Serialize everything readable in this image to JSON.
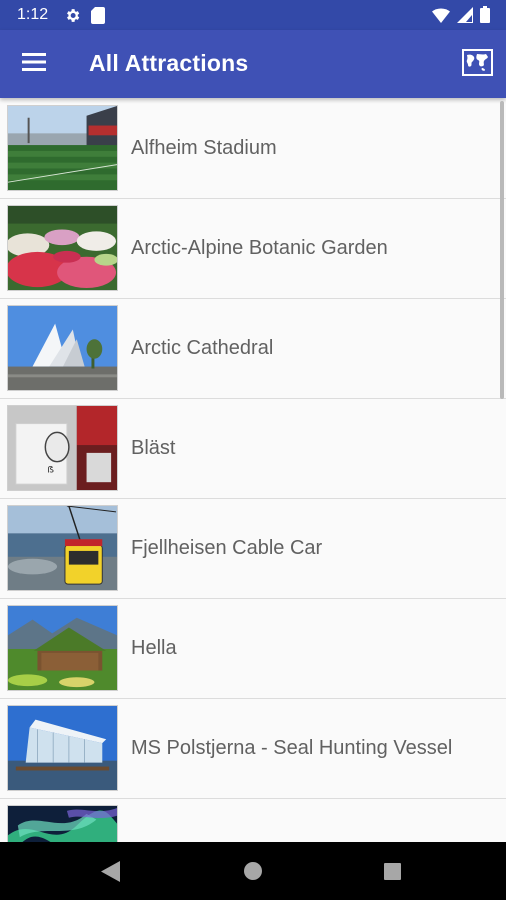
{
  "status_bar": {
    "time": "1:12",
    "left_icons": [
      "gear-icon",
      "sd-card-icon"
    ],
    "right_icons": [
      "wifi-icon",
      "cell-signal-icon",
      "battery-icon"
    ]
  },
  "app_bar": {
    "title": "All Attractions",
    "menu_icon": "hamburger-menu-icon",
    "action_icon": "map-icon",
    "color": "#3f51b5",
    "status_color": "#3349a8"
  },
  "attractions": [
    {
      "name": "Alfheim Stadium",
      "thumbnail": "stadium"
    },
    {
      "name": "Arctic-Alpine Botanic Garden",
      "thumbnail": "flower-garden"
    },
    {
      "name": "Arctic Cathedral",
      "thumbnail": "cathedral"
    },
    {
      "name": "Bläst",
      "thumbnail": "glass-studio"
    },
    {
      "name": "Fjellheisen Cable Car",
      "thumbnail": "cable-car"
    },
    {
      "name": "Hella",
      "thumbnail": "turf-house"
    },
    {
      "name": "MS Polstjerna - Seal Hunting Vessel",
      "thumbnail": "glass-building"
    },
    {
      "name": "",
      "thumbnail": "northern-lights"
    }
  ],
  "nav_bar": {
    "icons": [
      "back-icon",
      "home-icon",
      "recents-icon"
    ]
  }
}
